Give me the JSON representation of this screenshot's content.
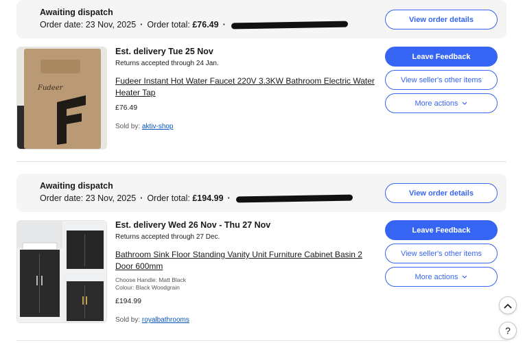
{
  "orders": [
    {
      "status": "Awaiting dispatch",
      "order_date_label": "Order date:",
      "order_date": "23 Nov, 2025",
      "order_total_label": "Order total:",
      "order_total": "£76.49",
      "view_order_label": "View order details",
      "eta": "Est. delivery Tue 25 Nov",
      "returns": "Returns accepted through 24 Jan.",
      "title": "Fudeer Instant Hot Water Faucet 220V 3.3KW Bathroom Electric Water Heater Tap",
      "price": "£76.49",
      "sold_by_label": "Sold by:",
      "seller": "aktiv-shop",
      "thumb_brand": "Fudeer",
      "leave_feedback_label": "Leave Feedback",
      "seller_items_label": "View seller's other items",
      "more_actions_label": "More actions"
    },
    {
      "status": "Awaiting dispatch",
      "order_date_label": "Order date:",
      "order_date": "23 Nov, 2025",
      "order_total_label": "Order total:",
      "order_total": "£194.99",
      "view_order_label": "View order details",
      "eta": "Est. delivery Wed 26 Nov - Thu 27 Nov",
      "returns": "Returns accepted through 27 Dec.",
      "title": "Bathroom Sink Floor Standing Vanity Unit Furniture Cabinet Basin 2 Door 600mm",
      "attr_handle": "Choose Handle: Matt Black",
      "attr_colour": "Colour: Black Woodgrain",
      "price": "£194.99",
      "sold_by_label": "Sold by:",
      "seller": "royalbathrooms",
      "leave_feedback_label": "Leave Feedback",
      "seller_items_label": "View seller's other items",
      "more_actions_label": "More actions"
    }
  ],
  "icons": {
    "chevron_down": "chevron-down-icon",
    "scroll_top": "chevron-up-icon",
    "help": "help-icon"
  },
  "help_glyph": "?",
  "colors": {
    "accent": "#3665f3",
    "link": "#0654ba",
    "header_bg": "#f5f5f5"
  }
}
